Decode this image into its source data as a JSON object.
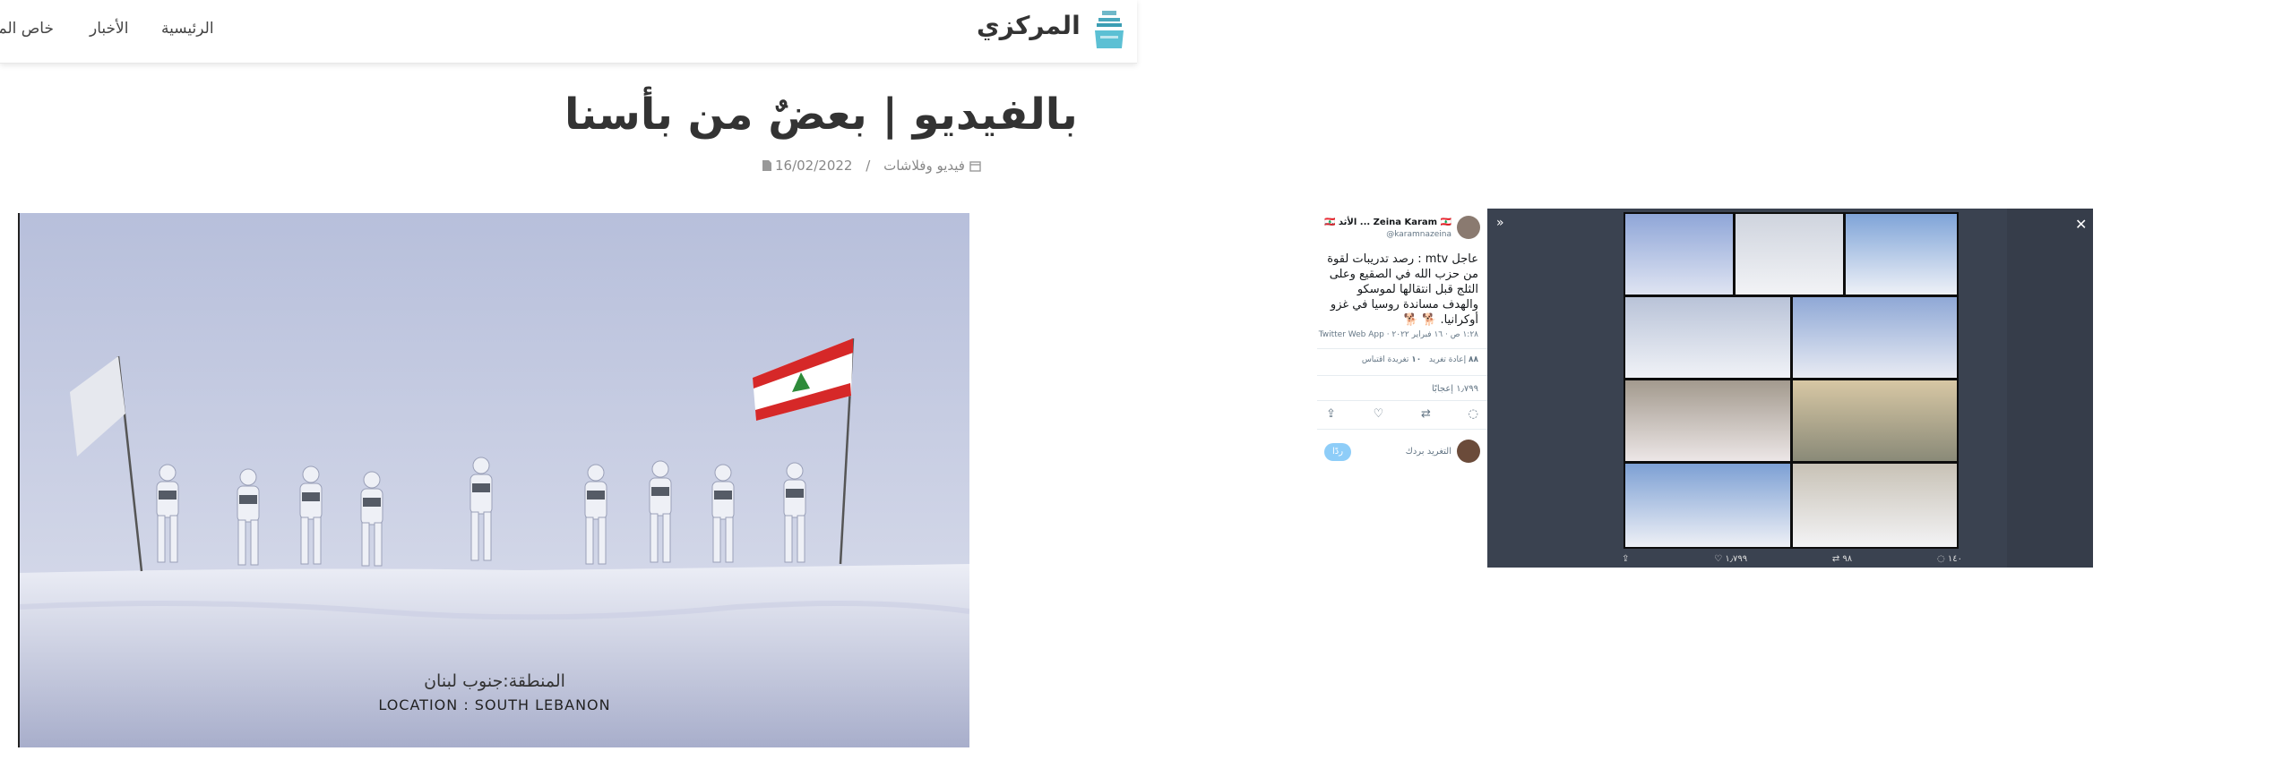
{
  "header": {
    "site_name": "المركزي",
    "nav": {
      "home": "الرئيسية",
      "news": "الأخبار",
      "private": "خاص المركزية"
    }
  },
  "article": {
    "title": "بالفيديو | بعضٌ من بأسنا",
    "date": "16/02/2022",
    "separator": "/",
    "category": "فيديو وفلاشات",
    "image_caption_ar": "المنطقة:جنوب لبنان",
    "image_caption_en": "LOCATION : SOUTH LEBANON"
  },
  "tweet": {
    "name": "Zeina Karam 🇱🇧 ... الأثد 🇱🇧",
    "handle": "@karamnazeina",
    "more": "···",
    "text": "عاجل mtv : رصد تدريبات لقوة من حزب الله في الصقيع وعلى الثلج قبل انتقالها لموسكو والهدف مساندة روسيا في غزو أوكرانيا. 🐕 🐕",
    "time": "١:٢٨ ص · ١٦ فبراير ٢٠٢٢ · Twitter Web App",
    "retweets_label": "إعادة تغريد",
    "retweets": "٨٨",
    "quotes_label": "تغريدة اقتباس",
    "quotes": "١٠",
    "likes": "١٫٧٩٩ إعجابًا",
    "reply_placeholder": "التغريد بردك",
    "reply_button": "ردًا",
    "actions": [
      "reply",
      "retweet",
      "like",
      "share"
    ],
    "media_bar": {
      "replies": "١٤٠",
      "retweets": "٩٨",
      "likes": "١٫٧٩٩"
    },
    "close": "✕",
    "collapse": "»"
  },
  "colors": {
    "header_bg": "#ffffff",
    "text_dark": "#333333",
    "meta_gray": "#888888",
    "twitter_blue": "#1da1f2",
    "lebanon_red": "#d62828",
    "snow": "#e9ecf4"
  }
}
